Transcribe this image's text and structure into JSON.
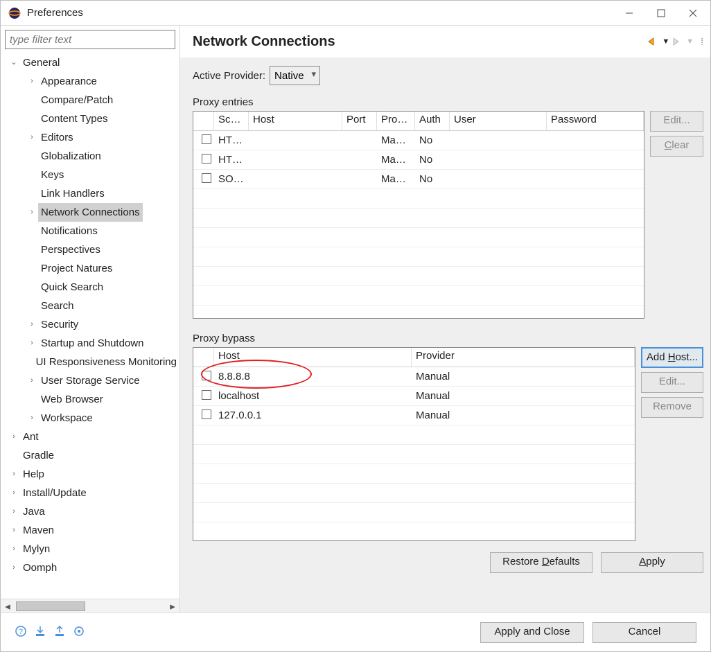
{
  "window": {
    "title": "Preferences"
  },
  "filter_placeholder": "type filter text",
  "tree": [
    {
      "label": "General",
      "depth": 0,
      "expanded": true,
      "hasChildren": true
    },
    {
      "label": "Appearance",
      "depth": 1,
      "hasChildren": true
    },
    {
      "label": "Compare/Patch",
      "depth": 1
    },
    {
      "label": "Content Types",
      "depth": 1
    },
    {
      "label": "Editors",
      "depth": 1,
      "hasChildren": true
    },
    {
      "label": "Globalization",
      "depth": 1
    },
    {
      "label": "Keys",
      "depth": 1
    },
    {
      "label": "Link Handlers",
      "depth": 1
    },
    {
      "label": "Network Connections",
      "depth": 1,
      "hasChildren": true,
      "selected": true
    },
    {
      "label": "Notifications",
      "depth": 1
    },
    {
      "label": "Perspectives",
      "depth": 1
    },
    {
      "label": "Project Natures",
      "depth": 1
    },
    {
      "label": "Quick Search",
      "depth": 1
    },
    {
      "label": "Search",
      "depth": 1
    },
    {
      "label": "Security",
      "depth": 1,
      "hasChildren": true
    },
    {
      "label": "Startup and Shutdown",
      "depth": 1,
      "hasChildren": true
    },
    {
      "label": "UI Responsiveness Monitoring",
      "depth": 1
    },
    {
      "label": "User Storage Service",
      "depth": 1,
      "hasChildren": true
    },
    {
      "label": "Web Browser",
      "depth": 1
    },
    {
      "label": "Workspace",
      "depth": 1,
      "hasChildren": true
    },
    {
      "label": "Ant",
      "depth": 0,
      "hasChildren": true
    },
    {
      "label": "Gradle",
      "depth": 0
    },
    {
      "label": "Help",
      "depth": 0,
      "hasChildren": true
    },
    {
      "label": "Install/Update",
      "depth": 0,
      "hasChildren": true
    },
    {
      "label": "Java",
      "depth": 0,
      "hasChildren": true
    },
    {
      "label": "Maven",
      "depth": 0,
      "hasChildren": true
    },
    {
      "label": "Mylyn",
      "depth": 0,
      "hasChildren": true
    },
    {
      "label": "Oomph",
      "depth": 0,
      "hasChildren": true
    }
  ],
  "page": {
    "title": "Network Connections",
    "active_provider_label": "Active Provider:",
    "active_provider_value": "Native",
    "proxy_entries_label": "Proxy entries",
    "proxy_entries_headers": {
      "scheme": "Sch…",
      "host": "Host",
      "port": "Port",
      "provider": "Pro…",
      "auth": "Auth",
      "user": "User",
      "password": "Password"
    },
    "proxy_entries_rows": [
      {
        "scheme": "HT…",
        "host": "",
        "port": "",
        "provider": "Ma…",
        "auth": "No",
        "user": "",
        "password": ""
      },
      {
        "scheme": "HT…",
        "host": "",
        "port": "",
        "provider": "Ma…",
        "auth": "No",
        "user": "",
        "password": ""
      },
      {
        "scheme": "SO…",
        "host": "",
        "port": "",
        "provider": "Ma…",
        "auth": "No",
        "user": "",
        "password": ""
      }
    ],
    "pe_buttons": {
      "edit": "Edit...",
      "clear": "Clear"
    },
    "proxy_bypass_label": "Proxy bypass",
    "proxy_bypass_headers": {
      "host": "Host",
      "provider": "Provider"
    },
    "proxy_bypass_rows": [
      {
        "host": "8.8.8.8",
        "provider": "Manual"
      },
      {
        "host": "localhost",
        "provider": "Manual"
      },
      {
        "host": "127.0.0.1",
        "provider": "Manual"
      }
    ],
    "pb_buttons": {
      "add": "Add Host...",
      "edit": "Edit...",
      "remove": "Remove"
    },
    "restore": "Restore Defaults",
    "apply": "Apply"
  },
  "footer": {
    "apply_close": "Apply and Close",
    "cancel": "Cancel"
  }
}
